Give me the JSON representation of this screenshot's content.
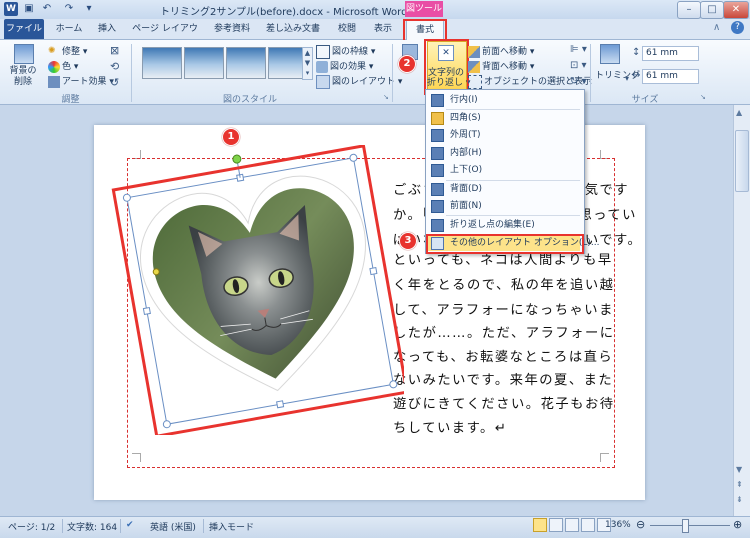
{
  "window": {
    "title": "トリミング2サンプル(before).docx - Microsoft Word",
    "context_tab_label": "図ツール",
    "min": "–",
    "max": "□",
    "close": "✕",
    "help": "?"
  },
  "tabs": [
    "ファイル",
    "ホーム",
    "挿入",
    "ページ レイアウト",
    "参考資料",
    "差し込み文書",
    "校閲",
    "表示",
    "書式"
  ],
  "ribbon": {
    "remove_bg": "背景の\n削除",
    "adjust": {
      "corrections": "修整",
      "color": "色",
      "artistic": "アート効果",
      "label": "調整"
    },
    "styles": {
      "border": "図の枠線",
      "effects": "図の効果",
      "layout": "図のレイアウト",
      "label": "図のスタイル"
    },
    "arrange": {
      "wrap_text_line1": "文字列の",
      "wrap_text_line2": "折り返し",
      "bring_forward": "前面へ移動",
      "send_backward": "背面へ移動",
      "selection_pane": "オブジェクトの選択と表示"
    },
    "size": {
      "crop": "トリミング",
      "height": "61 mm",
      "width": "61 mm",
      "label": "サイズ"
    }
  },
  "wrap_menu": {
    "items": [
      "行内(I)",
      "四角(S)",
      "外周(T)",
      "内部(H)",
      "上下(O)",
      "背面(D)",
      "前面(N)",
      "折り返し点の編集(E)",
      "その他のレイアウト オプション(L)..."
    ]
  },
  "document": {
    "lines": [
      "ごぶさたしていますが、お元気です",
      "か。「ずっとお会いしたいと思ってい",
      "ばいないので、お元気ではないです。",
      "といっても、ネコは人間よりも早",
      "く年をとるので、私の年を追い越",
      "して、アラフォーになっちゃいま",
      "したが……。ただ、アラフォーに",
      "なっても、お転婆なところは直ら",
      "ないみたいです。来年の夏、また",
      "遊びにきてください。花子もお待",
      "ちしています。↵"
    ]
  },
  "callouts": {
    "one": "1",
    "two": "2",
    "three": "3"
  },
  "status": {
    "page": "ページ: 1/2",
    "words": "文字数: 164",
    "language": "英語 (米国)",
    "mode": "挿入モード",
    "zoom": "136%"
  },
  "colors": {
    "accent": "#2a5699",
    "callout": "#e8332e",
    "context": "#e94ea5"
  }
}
